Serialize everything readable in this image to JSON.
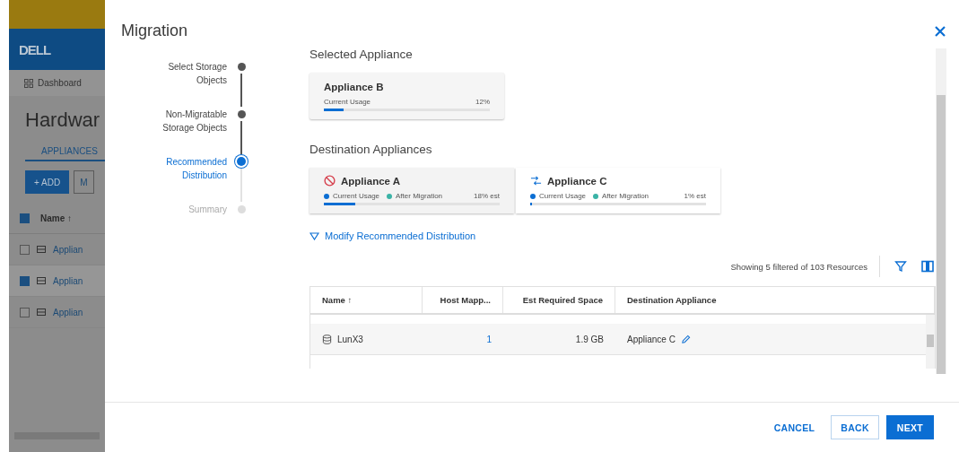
{
  "background_app": {
    "logo": "DELL",
    "nav_item": "Dashboard",
    "title": "Hardwar",
    "tab": {
      "label": "APPLIANCES",
      "selected": true
    },
    "buttons": [
      {
        "label": "+ ADD",
        "kind": "primary"
      },
      {
        "label": "M",
        "kind": "outline"
      }
    ],
    "header": {
      "checked": true,
      "label": "Name ↑"
    },
    "rows": [
      {
        "name": "Applian",
        "checked": false
      },
      {
        "name": "Applian",
        "checked": true
      },
      {
        "name": "Applian",
        "checked": false
      }
    ]
  },
  "dialog": {
    "title": "Migration",
    "steps": [
      {
        "label": "Select Storage Objects",
        "completed": true,
        "selected": false
      },
      {
        "label": "Non-Migratable Storage Objects",
        "completed": true,
        "selected": false
      },
      {
        "label": "Recommended Distribution",
        "completed": false,
        "selected": true
      },
      {
        "label": "Summary",
        "completed": false,
        "selected": false
      }
    ],
    "selected_heading": "Selected Appliance",
    "selected_appliance": {
      "name": "Appliance B",
      "usage_label": "Current Usage",
      "reading": "12%",
      "level": 0.12
    },
    "destination_heading": "Destination Appliances",
    "destinations": [
      {
        "name": "Appliance A",
        "kind": "blocked",
        "selected": true,
        "legend": [
          {
            "label": "Current Usage",
            "color": "#0b6ed3"
          },
          {
            "label": "After Migration",
            "color": "#3bb3a6"
          }
        ],
        "reading": "18% est",
        "level": 0.18
      },
      {
        "name": "Appliance C",
        "kind": "transfer",
        "selected": false,
        "legend": [
          {
            "label": "Current Usage",
            "color": "#0b6ed3"
          },
          {
            "label": "After Migration",
            "color": "#3bb3a6"
          }
        ],
        "reading": "1% est",
        "level": 0.01
      }
    ],
    "modify_link": "Modify Recommended Distribution",
    "table_summary": "Showing 5 filtered of 103 Resources",
    "table": {
      "columns": [
        "Name ↑",
        "Host Mapp...",
        "Est Required Space",
        "Destination Appliance"
      ],
      "rows": [
        {
          "name": "LunX3",
          "host_mappings": "1",
          "space": "1.9 GB",
          "destination": "Appliance C"
        }
      ]
    },
    "buttons": [
      {
        "label": "CANCEL",
        "kind": "text"
      },
      {
        "label": "BACK",
        "kind": "outline"
      },
      {
        "label": "NEXT",
        "kind": "primary"
      }
    ]
  }
}
